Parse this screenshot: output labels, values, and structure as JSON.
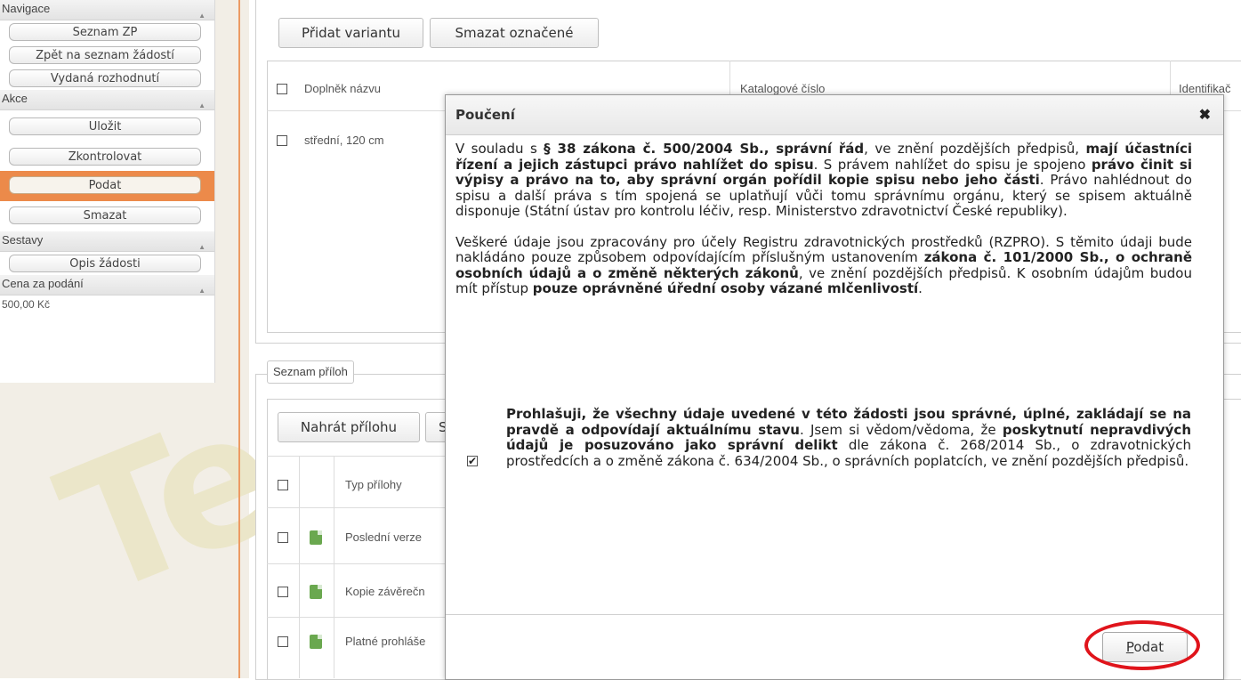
{
  "sidebar": {
    "sections": [
      {
        "title": "Navigace",
        "buttons": [
          "Seznam ZP",
          "Zpět na seznam žádostí",
          "Vydaná rozhodnutí"
        ]
      },
      {
        "title": "Akce",
        "buttons": [
          "Uložit",
          "Zkontrolovat",
          "Podat",
          "Smazat"
        ]
      },
      {
        "title": "Sestavy",
        "buttons": [
          "Opis žádosti"
        ]
      },
      {
        "title": "Cena za podání",
        "value": "500,00 Kč"
      }
    ]
  },
  "variants": {
    "add_button": "Přidat variantu",
    "delete_button": "Smazat označené",
    "columns": [
      "Doplněk názvu",
      "Katalogové číslo",
      "Identifikač"
    ],
    "rows": [
      {
        "name": "střední, 120 cm"
      }
    ]
  },
  "attachments": {
    "tab_label": "Seznam příloh",
    "upload_button": "Nahrát přílohu",
    "second_button_partial": "S",
    "column_type": "Typ přílohy",
    "rows": [
      "Poslední verze",
      "Kopie závěrečn",
      "Platné prohláše"
    ]
  },
  "dialog": {
    "title": "Poučení",
    "close_symbol": "✖",
    "checkbox_checked": true,
    "submit_label_underlined": "P",
    "submit_label_rest": "odat"
  },
  "colors": {
    "accent": "#ec8a4a",
    "highlight_ring": "#e0141b"
  }
}
